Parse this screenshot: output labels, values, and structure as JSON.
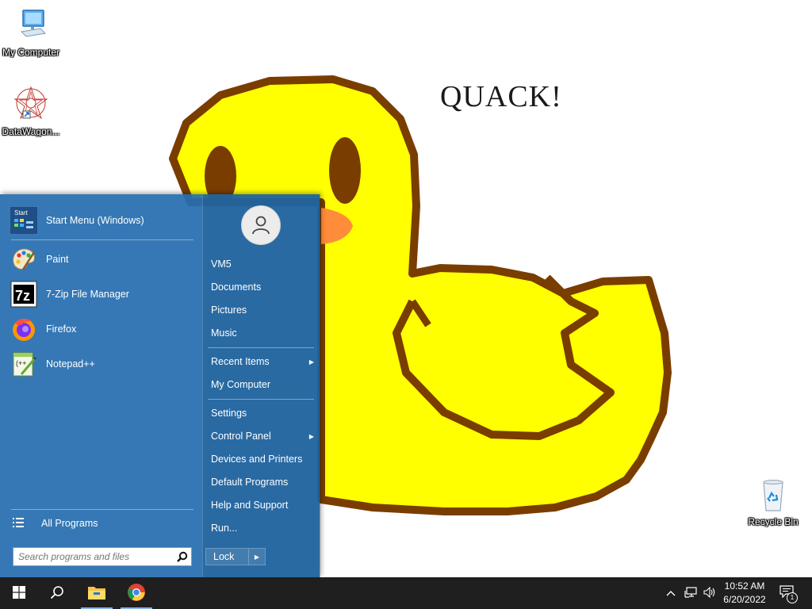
{
  "desktop": {
    "icons": [
      {
        "label": "My Computer",
        "icon": "computer-icon"
      },
      {
        "label": "DataWagon...",
        "icon": "datawagon-icon"
      },
      {
        "label": "Recycle Bin",
        "icon": "recycle-bin-icon"
      }
    ],
    "wallpaper_text": "QUACK!",
    "colors": {
      "duck_body": "#ffff00",
      "duck_outline": "#7a3d00",
      "beak": "#ff8c3a"
    }
  },
  "start_menu": {
    "pinned": [
      {
        "label": "Start Menu (Windows)",
        "icon": "start-menu-app-icon"
      },
      {
        "label": "Paint",
        "icon": "paint-palette-icon"
      },
      {
        "label": "7-Zip File Manager",
        "icon": "7zip-icon"
      },
      {
        "label": "Firefox",
        "icon": "firefox-icon"
      },
      {
        "label": "Notepad++",
        "icon": "notepadpp-icon"
      }
    ],
    "all_programs_label": "All Programs",
    "search_placeholder": "Search programs and files",
    "user_icon": "user-icon",
    "right_items": [
      {
        "label": "VM5",
        "submenu": false
      },
      {
        "label": "Documents",
        "submenu": false
      },
      {
        "label": "Pictures",
        "submenu": false
      },
      {
        "label": "Music",
        "submenu": false
      },
      {
        "label": "Recent Items",
        "submenu": true
      },
      {
        "label": "My Computer",
        "submenu": false
      },
      {
        "label": "Settings",
        "submenu": false
      },
      {
        "label": "Control Panel",
        "submenu": true
      },
      {
        "label": "Devices and Printers",
        "submenu": false
      },
      {
        "label": "Default Programs",
        "submenu": false
      },
      {
        "label": "Help and Support",
        "submenu": false
      },
      {
        "label": "Run...",
        "submenu": false
      }
    ],
    "lock_label": "Lock",
    "colors": {
      "background": "#266eaf"
    }
  },
  "taskbar": {
    "buttons": [
      "windows-start-icon",
      "search-icon",
      "file-explorer-icon",
      "chrome-icon"
    ],
    "tray_icons": [
      "chevron-up-icon",
      "network-icon",
      "volume-icon"
    ],
    "time": "10:52 AM",
    "date": "6/20/2022",
    "notification_count": "1"
  }
}
